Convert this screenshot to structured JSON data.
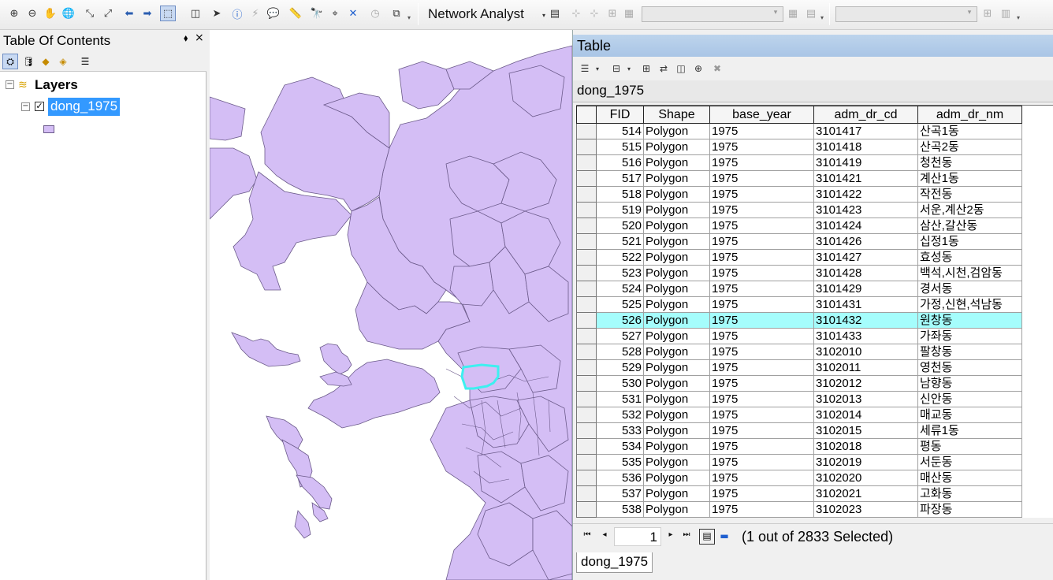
{
  "toolbar": {
    "network_analyst_label": "Network Analyst"
  },
  "toc": {
    "title": "Table Of Contents",
    "pin_glyph": "⬧",
    "close_glyph": "×",
    "layers_label": "Layers",
    "layer_name": "dong_1975",
    "expander_glyph": "−",
    "check_glyph": "✓",
    "legend_fill": "#d4bef5"
  },
  "map": {
    "fill_color": "#d4bef5",
    "stroke_color": "#6b5a8a",
    "highlight_color": "#3df0f0"
  },
  "table": {
    "window_title": "Table",
    "tab_label": "dong_1975",
    "bottom_tab_label": "dong_1975",
    "columns": [
      "FID",
      "Shape",
      "base_year",
      "adm_dr_cd",
      "adm_dr_nm"
    ],
    "rows": [
      {
        "fid": "514",
        "shape": "Polygon",
        "base_year": "1975",
        "cd": "3101417",
        "nm": "산곡1동",
        "selected": false
      },
      {
        "fid": "515",
        "shape": "Polygon",
        "base_year": "1975",
        "cd": "3101418",
        "nm": "산곡2동",
        "selected": false
      },
      {
        "fid": "516",
        "shape": "Polygon",
        "base_year": "1975",
        "cd": "3101419",
        "nm": "청천동",
        "selected": false
      },
      {
        "fid": "517",
        "shape": "Polygon",
        "base_year": "1975",
        "cd": "3101421",
        "nm": "계산1동",
        "selected": false
      },
      {
        "fid": "518",
        "shape": "Polygon",
        "base_year": "1975",
        "cd": "3101422",
        "nm": "작전동",
        "selected": false
      },
      {
        "fid": "519",
        "shape": "Polygon",
        "base_year": "1975",
        "cd": "3101423",
        "nm": "서운,계산2동",
        "selected": false
      },
      {
        "fid": "520",
        "shape": "Polygon",
        "base_year": "1975",
        "cd": "3101424",
        "nm": "삼산,갈산동",
        "selected": false
      },
      {
        "fid": "521",
        "shape": "Polygon",
        "base_year": "1975",
        "cd": "3101426",
        "nm": "십정1동",
        "selected": false
      },
      {
        "fid": "522",
        "shape": "Polygon",
        "base_year": "1975",
        "cd": "3101427",
        "nm": "효성동",
        "selected": false
      },
      {
        "fid": "523",
        "shape": "Polygon",
        "base_year": "1975",
        "cd": "3101428",
        "nm": "백석,시천,검암동",
        "selected": false
      },
      {
        "fid": "524",
        "shape": "Polygon",
        "base_year": "1975",
        "cd": "3101429",
        "nm": "경서동",
        "selected": false
      },
      {
        "fid": "525",
        "shape": "Polygon",
        "base_year": "1975",
        "cd": "3101431",
        "nm": "가정,신현,석남동",
        "selected": false
      },
      {
        "fid": "526",
        "shape": "Polygon",
        "base_year": "1975",
        "cd": "3101432",
        "nm": "원창동",
        "selected": true
      },
      {
        "fid": "527",
        "shape": "Polygon",
        "base_year": "1975",
        "cd": "3101433",
        "nm": "가좌동",
        "selected": false
      },
      {
        "fid": "528",
        "shape": "Polygon",
        "base_year": "1975",
        "cd": "3102010",
        "nm": "팔창동",
        "selected": false
      },
      {
        "fid": "529",
        "shape": "Polygon",
        "base_year": "1975",
        "cd": "3102011",
        "nm": "영천동",
        "selected": false
      },
      {
        "fid": "530",
        "shape": "Polygon",
        "base_year": "1975",
        "cd": "3102012",
        "nm": "남향동",
        "selected": false
      },
      {
        "fid": "531",
        "shape": "Polygon",
        "base_year": "1975",
        "cd": "3102013",
        "nm": "신안동",
        "selected": false
      },
      {
        "fid": "532",
        "shape": "Polygon",
        "base_year": "1975",
        "cd": "3102014",
        "nm": "매교동",
        "selected": false
      },
      {
        "fid": "533",
        "shape": "Polygon",
        "base_year": "1975",
        "cd": "3102015",
        "nm": "세류1동",
        "selected": false
      },
      {
        "fid": "534",
        "shape": "Polygon",
        "base_year": "1975",
        "cd": "3102018",
        "nm": "평동",
        "selected": false
      },
      {
        "fid": "535",
        "shape": "Polygon",
        "base_year": "1975",
        "cd": "3102019",
        "nm": "서둔동",
        "selected": false
      },
      {
        "fid": "536",
        "shape": "Polygon",
        "base_year": "1975",
        "cd": "3102020",
        "nm": "매산동",
        "selected": false
      },
      {
        "fid": "537",
        "shape": "Polygon",
        "base_year": "1975",
        "cd": "3102021",
        "nm": "고화동",
        "selected": false
      },
      {
        "fid": "538",
        "shape": "Polygon",
        "base_year": "1975",
        "cd": "3102023",
        "nm": "파장동",
        "selected": false
      }
    ],
    "selection_color": "#a5fdfc",
    "nav": {
      "first_glyph": "⏮",
      "prev_glyph": "◂",
      "next_glyph": "▸",
      "last_glyph": "⏭",
      "page_value": "1",
      "selection_status": "(1 out of 2833 Selected)"
    }
  }
}
